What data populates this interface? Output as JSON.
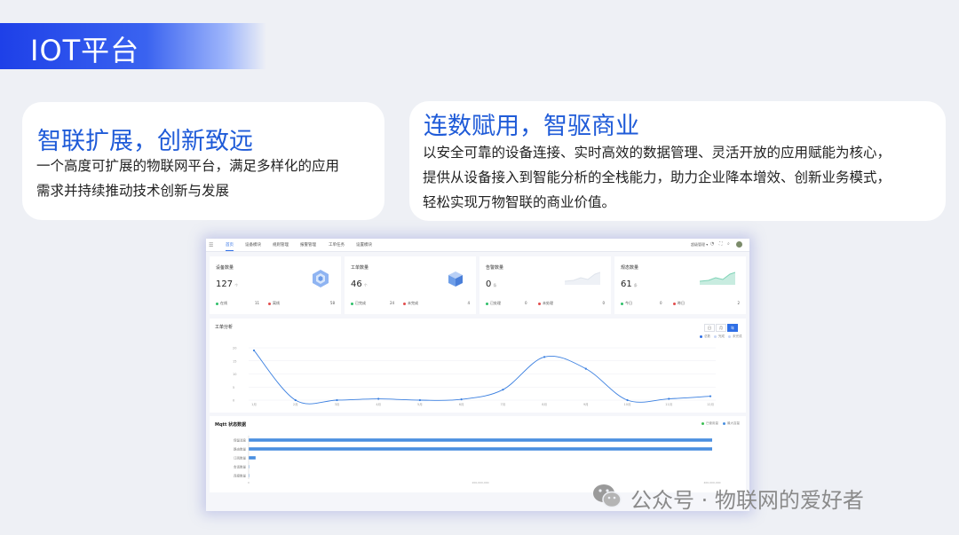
{
  "banner": {
    "title": "IOT平台"
  },
  "card_left": {
    "title": "智联扩展，创新致远",
    "lines": [
      "一个高度可扩展的物联网平台，满足多样化的应用",
      "需求并持续推动技术创新与发展"
    ]
  },
  "card_right": {
    "title": "连数赋用，智驱商业",
    "lines": [
      "以安全可靠的设备连接、实时高效的数据管理、灵活开放的应用赋能为核心，",
      "提供从设备接入到智能分析的全栈能力，助力企业降本增效、创新业务模式，",
      "轻松实现万物智联的商业价值。"
    ]
  },
  "dashboard": {
    "nav": {
      "menu_icon": "menu-icon",
      "items": [
        "首页",
        "设备模块",
        "规则管理",
        "报警管理",
        "工单任务",
        "设置模块"
      ],
      "active": 0,
      "user_label": "超级管理 ▾",
      "icons": [
        "bell-icon",
        "fullscreen-icon",
        "search-icon"
      ]
    },
    "stats": [
      {
        "title": "设备数量",
        "value": "127",
        "unit": "个",
        "foot": [
          {
            "label": "在线",
            "value": "11",
            "color": "#2fbf6a"
          },
          {
            "label": "离线",
            "value": "58",
            "color": "#e24c4c"
          }
        ],
        "visual": "hexagon-icon"
      },
      {
        "title": "工单数量",
        "value": "46",
        "unit": "个",
        "foot": [
          {
            "label": "已完成",
            "value": "24",
            "color": "#2fbf6a"
          },
          {
            "label": "未完成",
            "value": "4",
            "color": "#e24c4c"
          }
        ],
        "visual": "cube-icon"
      },
      {
        "title": "告警数量",
        "value": "0",
        "unit": "条",
        "foot": [
          {
            "label": "已处理",
            "value": "0",
            "color": "#2fbf6a"
          },
          {
            "label": "未处理",
            "value": "0",
            "color": "#e24c4c"
          }
        ],
        "visual": "sparkline"
      },
      {
        "title": "规态数量",
        "value": "61",
        "unit": "条",
        "foot": [
          {
            "label": "今日",
            "value": "0",
            "color": "#2fbf6a"
          },
          {
            "label": "昨日",
            "value": "2",
            "color": "#e24c4c"
          }
        ],
        "visual": "sparkline"
      }
    ],
    "work_panel": {
      "title": "工单分析",
      "segments": [
        "日",
        "月",
        "年"
      ],
      "active_segment": 2,
      "legend": [
        "总数",
        "完成",
        "未完成"
      ]
    },
    "mqtt_panel": {
      "title": "Mqtt 状态数据",
      "legend": [
        {
          "label": "已使用量",
          "color": "#3dbf54"
        },
        {
          "label": "最大容量",
          "color": "#4a8fe0"
        }
      ],
      "x_ticks": [
        "0",
        "200,000,000",
        "400,000,000"
      ]
    }
  },
  "watermark": {
    "icon": "wechat-icon",
    "text": "公众号 · 物联网的爱好者"
  },
  "colors": {
    "accent": "#1f5bd8",
    "banner": "#1e40e8",
    "line": "#3a7fe0",
    "bar": "#4a8fe0"
  },
  "chart_data": [
    {
      "type": "line",
      "x": [
        "1月",
        "2月",
        "3月",
        "4月",
        "5月",
        "6月",
        "7月",
        "8月",
        "9月",
        "10月",
        "11月",
        "12月"
      ],
      "series": [
        {
          "name": "总数",
          "values": [
            19,
            0,
            0,
            0.5,
            0,
            0.3,
            4,
            16.5,
            12,
            0,
            0.5,
            1.5
          ]
        }
      ],
      "ylim": [
        0,
        20
      ],
      "yticks": [
        0,
        5,
        10,
        15,
        20
      ],
      "grid": true
    },
    {
      "type": "bar",
      "orientation": "horizontal",
      "categories": [
        "保留消息",
        "路由数量",
        "订阅数量",
        "会话数量",
        "连接数量"
      ],
      "series": [
        {
          "name": "已使用量",
          "values": [
            0,
            0,
            0,
            0,
            0
          ]
        },
        {
          "name": "最大容量",
          "values": [
            400000000,
            400000000,
            6000000,
            0,
            0
          ]
        }
      ],
      "xlim": [
        0,
        400000000
      ]
    }
  ]
}
